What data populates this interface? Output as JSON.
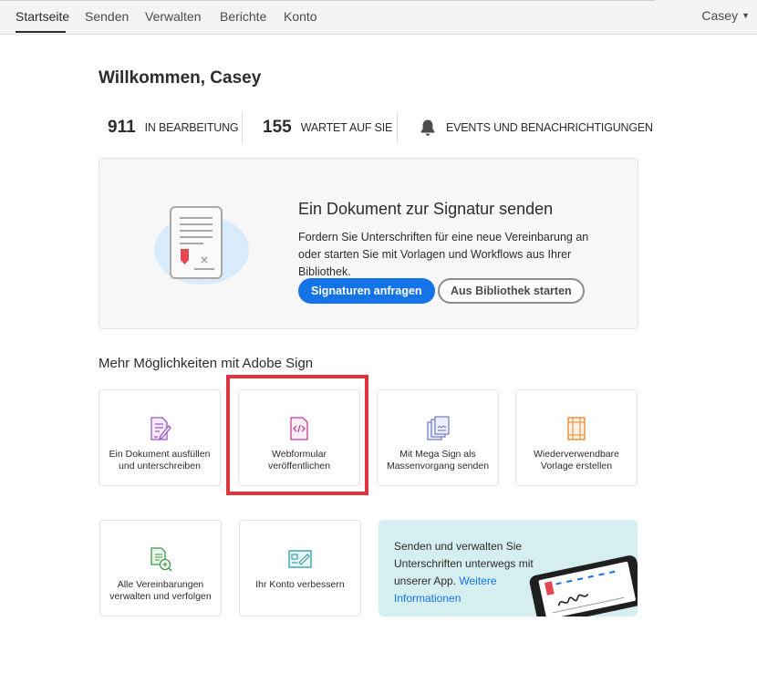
{
  "nav": {
    "items": [
      {
        "label": "Startseite",
        "active": true
      },
      {
        "label": "Senden"
      },
      {
        "label": "Verwalten"
      },
      {
        "label": "Berichte"
      },
      {
        "label": "Konto"
      }
    ],
    "user": "Casey"
  },
  "welcome": "Willkommen, Casey",
  "stats": [
    {
      "count": "911",
      "label": "IN BEARBEITUNG"
    },
    {
      "count": "155",
      "label": "WARTET AUF SIE"
    },
    {
      "label": "EVENTS UND BENACHRICHTIGUNGEN",
      "icon": "bell-icon"
    }
  ],
  "hero": {
    "title": "Ein Dokument zur Signatur senden",
    "description": "Fordern Sie Unterschriften für eine neue Vereinbarung an oder starten Sie mit Vorlagen und Workflows aus Ihrer Bibliothek.",
    "primary_button": "Signaturen anfragen",
    "secondary_button": "Aus Bibliothek starten"
  },
  "section_title": "Mehr Möglichkeiten mit Adobe Sign",
  "cards": [
    {
      "label_line1": "Ein Dokument ausfüllen",
      "label_line2": "und unterschreiben",
      "icon": "fill-sign-icon"
    },
    {
      "label_line1": "Webformular",
      "label_line2": "veröffentlichen",
      "icon": "web-form-icon",
      "highlighted": true
    },
    {
      "label_line1": "Mit Mega Sign als",
      "label_line2": "Massenvorgang senden",
      "icon": "mega-sign-icon"
    },
    {
      "label_line1": "Wiederverwendbare",
      "label_line2": "Vorlage erstellen",
      "icon": "template-icon"
    },
    {
      "label_line1": "Alle Vereinbarungen",
      "label_line2": "verwalten und verfolgen",
      "icon": "manage-agreements-icon"
    },
    {
      "label_line1": "Ihr Konto verbessern",
      "label_line2": "",
      "icon": "upgrade-account-icon"
    }
  ],
  "promo": {
    "text": "Senden und verwalten Sie Unterschriften unterwegs mit unserer App. ",
    "link": "Weitere Informationen"
  },
  "colors": {
    "accent": "#1473e6",
    "highlight": "#e0333c",
    "promo_bg": "#d5eef0"
  }
}
